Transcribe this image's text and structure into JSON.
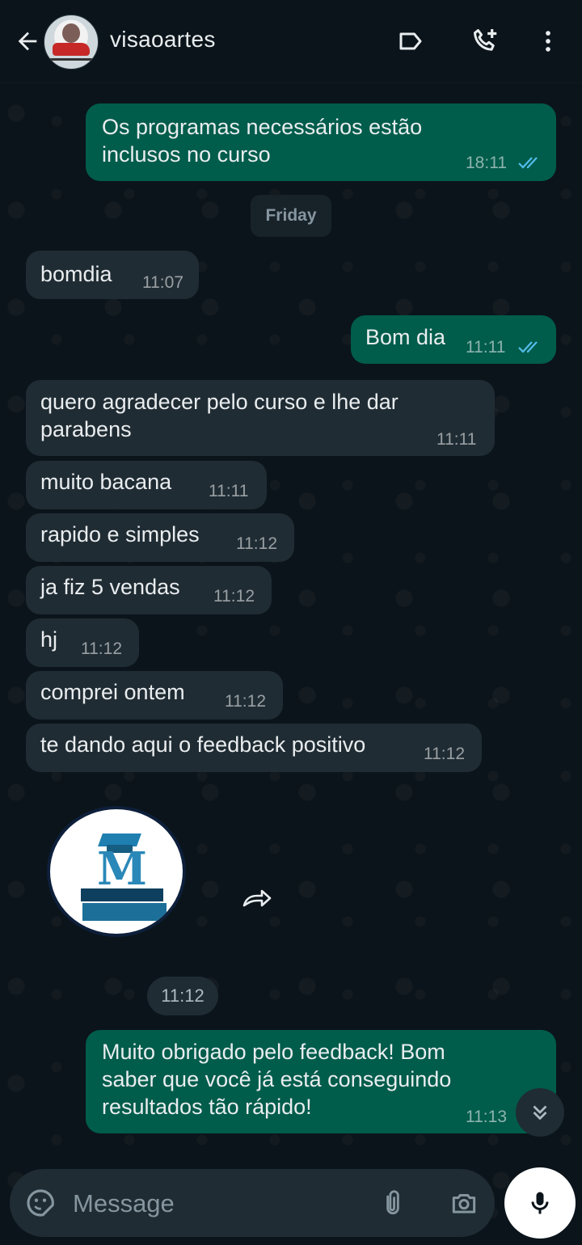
{
  "header": {
    "contact_name": "visaoartes"
  },
  "day_separator": "Friday",
  "messages": [
    {
      "dir": "out",
      "text_lines": [
        "Os programas necessários estão",
        "inclusos no curso"
      ],
      "time": "18:11",
      "read": true
    },
    {
      "dir": "in",
      "text_lines": [
        "bomdia"
      ],
      "time": "11:07"
    },
    {
      "dir": "out",
      "text_lines": [
        "Bom dia"
      ],
      "time": "11:11",
      "read": true
    },
    {
      "dir": "in",
      "text_lines": [
        "quero agradecer pelo curso  e lhe dar",
        "parabens"
      ],
      "time": "11:11"
    },
    {
      "dir": "in",
      "text_lines": [
        "muito bacana"
      ],
      "time": "11:11"
    },
    {
      "dir": "in",
      "text_lines": [
        "rapido e simples"
      ],
      "time": "11:12"
    },
    {
      "dir": "in",
      "text_lines": [
        "ja fiz 5 vendas"
      ],
      "time": "11:12"
    },
    {
      "dir": "in",
      "text_lines": [
        "hj"
      ],
      "time": "11:12"
    },
    {
      "dir": "in",
      "text_lines": [
        "comprei ontem"
      ],
      "time": "11:12"
    },
    {
      "dir": "in",
      "text_lines": [
        "te dando aqui o feedback positivo"
      ],
      "time": "11:12"
    },
    {
      "dir": "out",
      "text_lines": [
        "Muito obrigado pelo feedback! Bom",
        "saber que você já está conseguindo",
        "resultados tão rápido!"
      ],
      "time": "11:13"
    }
  ],
  "sticker": {
    "letter": "M",
    "time": "11:12"
  },
  "composer": {
    "placeholder": "Message"
  },
  "colors": {
    "background": "#0b141a",
    "incoming_bubble": "#202c33",
    "outgoing_bubble": "#005c4b",
    "read_tick": "#53bdeb"
  },
  "icons": [
    "back-arrow-icon",
    "label-icon",
    "add-call-icon",
    "more-vert-icon",
    "forward-icon",
    "chevron-double-down-icon",
    "sticker-emoji-icon",
    "paperclip-icon",
    "camera-icon",
    "mic-icon"
  ]
}
